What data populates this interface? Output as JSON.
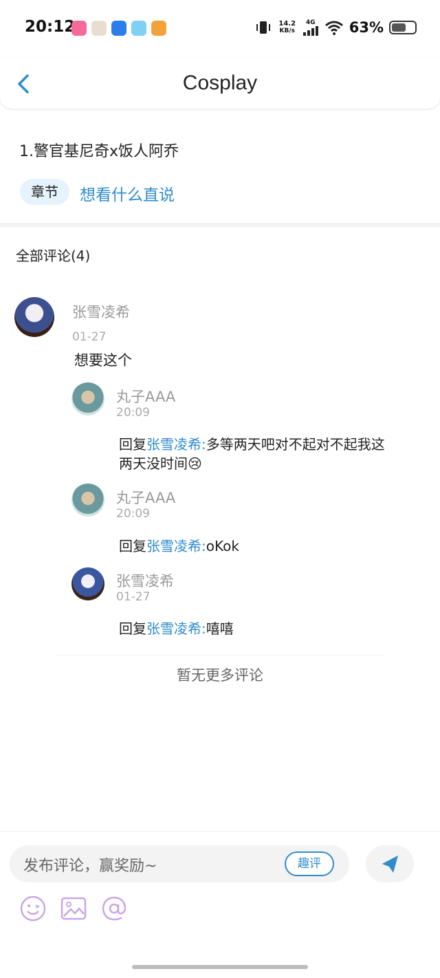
{
  "status_bar": {
    "time": "20:12",
    "net_speed_value": "14.2",
    "net_speed_unit": "KB/s",
    "network_type": "4G",
    "battery_percent": "63%",
    "battery_level": 0.63
  },
  "header": {
    "title": "Cosplay"
  },
  "chapter": {
    "title": "1.警官基尼奇x饭人阿乔",
    "tag": "章节",
    "hint": "想看什么直说"
  },
  "comments_section": {
    "header": "全部评论(4)",
    "comment": {
      "username": "张雪凌希",
      "date": "01-27",
      "text": "想要这个"
    },
    "replies": [
      {
        "username": "丸子AAA",
        "time": "20:09",
        "prefix": "回复",
        "mention": "张雪凌希:",
        "line1": "多等两天吧对不起对不起我这",
        "line2": "两天没时间😢"
      },
      {
        "username": "丸子AAA",
        "time": "20:09",
        "prefix": "回复",
        "mention": "张雪凌希:",
        "text": "oKok"
      },
      {
        "username": "张雪凌希",
        "time": "01-27",
        "prefix": "回复",
        "mention": "张雪凌希:",
        "text": "嘻嘻"
      }
    ],
    "no_more": "暂无更多评论"
  },
  "bottom_bar": {
    "input_placeholder": "发布评论，赢奖励~",
    "quping_label": "趣评",
    "icons": [
      "emoji-icon",
      "image-icon",
      "mention-icon",
      "send-icon"
    ]
  },
  "colors": {
    "accent": "#2f8ccc",
    "tag_bg": "#e6f3fc",
    "tool_icon": "#c9a6e8"
  }
}
